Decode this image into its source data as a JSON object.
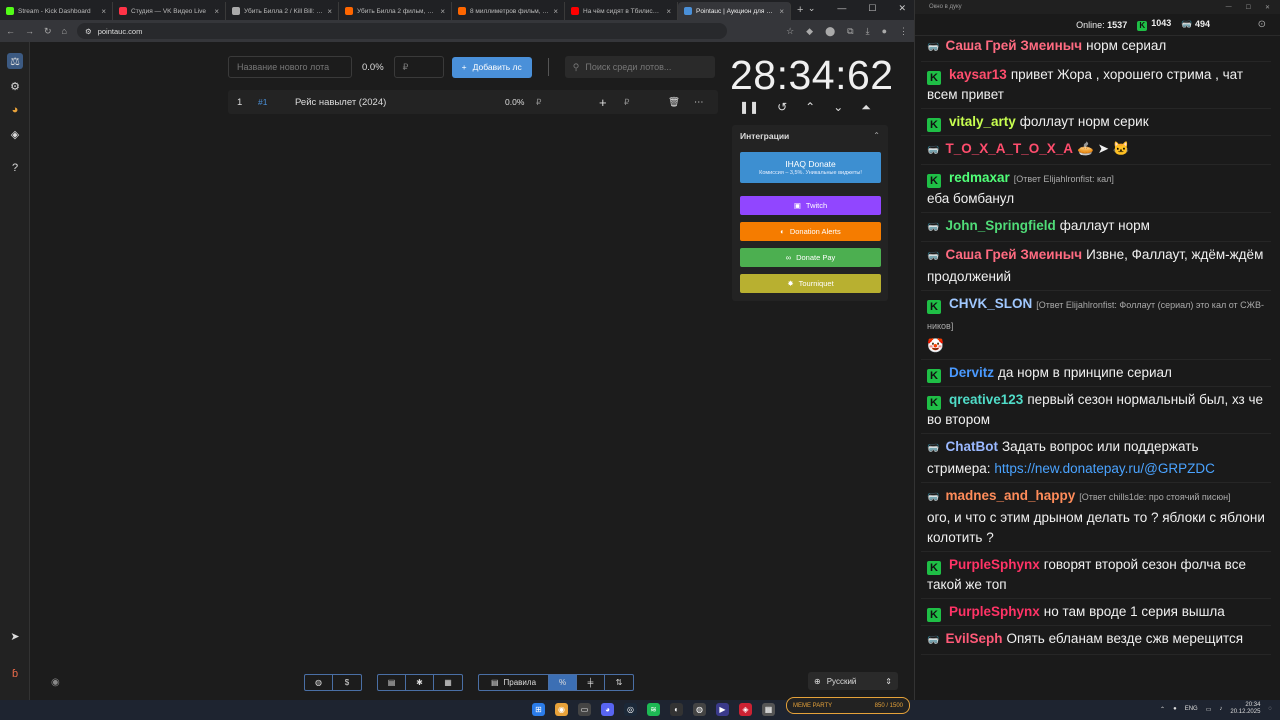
{
  "browser": {
    "tabs": [
      {
        "title": "Stream - Kick Dashboard",
        "color": "#53fc18"
      },
      {
        "title": "Студия — VK Видео Live",
        "color": "#ff3347"
      },
      {
        "title": "Убить Билла 2 / Kill Bill: Vol.",
        "color": "#aaaaaa"
      },
      {
        "title": "Убить Билла 2 фильм, 2004 -",
        "color": "#ff6600"
      },
      {
        "title": "8 миллиметров фильм, 199",
        "color": "#ff6600"
      },
      {
        "title": "На чём сидят в Тбилиси / V",
        "color": "#ff0000"
      },
      {
        "title": "Pointauc | Аукцион для стр",
        "color": "#4a90d9",
        "active": true
      }
    ],
    "url": "pointauc.com"
  },
  "auction": {
    "new_lot_placeholder": "Название нового лота",
    "percent": "0.0%",
    "amount_placeholder": "₽",
    "add_button": "Добавить лс",
    "search_placeholder": "Поиск среди лотов...",
    "lots": [
      {
        "index": "1",
        "id": "#1",
        "name": "Рейс навылет (2024)",
        "percent": "0.0%",
        "currency": "₽",
        "add_currency": "₽"
      }
    ],
    "timer": "28:34:62"
  },
  "integrations": {
    "title": "Интеграции",
    "ihaq": {
      "label": "IHAQ Donate",
      "sub": "Комиссия – 3,5%. Уникальные виджеты!"
    },
    "buttons": [
      {
        "label": "Twitch",
        "color": "#9146ff"
      },
      {
        "label": "Donation Alerts",
        "color": "#f57c00"
      },
      {
        "label": "Donate Pay",
        "color": "#4caf50"
      },
      {
        "label": "Tourniquet",
        "color": "#b8b030"
      }
    ]
  },
  "bottombar": {
    "rules": "Правила",
    "language": "Русский"
  },
  "chat": {
    "window_title": "Окно в дуку",
    "online_label": "Online:",
    "online": "1537",
    "kick_count": "1043",
    "other_count": "494",
    "messages": [
      {
        "badge": "g",
        "name": "Саша Грей Змеиныч",
        "color": "#ff6b81",
        "text": "норм сериал"
      },
      {
        "badge": "k",
        "name": "kaysar13",
        "color": "#ff4d6d",
        "text": "привет Жора , хорошего стрима , чат всем привет"
      },
      {
        "badge": "k",
        "name": "vitaly_arty",
        "color": "#c8ff50",
        "text": "фоллаут норм серик"
      },
      {
        "badge": "g",
        "name": "T_O_X_A_T_O_X_A",
        "color": "#ff4d6d",
        "text": "🥧 ➤ 🐱"
      },
      {
        "badge": "k",
        "name": "redmaxar",
        "color": "#50ff78",
        "reply": "[Ответ Elijahlronfist: кал]",
        "text": "еба бомбанул"
      },
      {
        "badge": "g",
        "name": "John_Springfield",
        "color": "#50dc78",
        "text": "фаллаут норм"
      },
      {
        "badge": "g",
        "name": "Саша Грей Змеиныч",
        "color": "#ff6b81",
        "text": "Извне, Фаллаут, ждём-ждём продолжений"
      },
      {
        "badge": "k",
        "name": "CHVK_SLON",
        "color": "#a0c8ff",
        "reply": "[Ответ Elijahlronfist: Фоллаут (сериал) это кал от СЖВ-ников]",
        "text": "🤡"
      },
      {
        "badge": "k",
        "name": "Dervitz",
        "color": "#4a9aff",
        "text": "да норм в принципе сериал"
      },
      {
        "badge": "k",
        "name": "qreative123",
        "color": "#50dcc8",
        "text": "первый сезон нормальный был, хз че во втором"
      },
      {
        "badge": "g",
        "name": "ChatBot",
        "color": "#9ab8ff",
        "text": "Задать вопрос или поддержать стримера:",
        "link": "https://new.donatepay.ru/@GRPZDC"
      },
      {
        "badge": "g",
        "name": "madnes_and_happy",
        "color": "#ff8c5a",
        "reply": "[Ответ chills1de: про стоячий писюн]",
        "text": "ого, и что с этим дрыном делать то ? яблоки с яблони колотить ?"
      },
      {
        "badge": "k",
        "name": "PurpleSphynx",
        "color": "#ff3366",
        "text": "говорят второй сезон фолча все такой же топ"
      },
      {
        "badge": "k",
        "name": "PurpleSphynx",
        "color": "#ff3366",
        "text": "но там вроде 1 серия вышла"
      },
      {
        "badge": "g",
        "name": "EvilSeph",
        "color": "#ff5a78",
        "text": "Опять ебланам везде сжв мерещится"
      }
    ]
  },
  "taskbar": {
    "meme_label": "MEME PARTY",
    "meme_progress": "850 / 1500",
    "lang": "ENG",
    "time": "20:34",
    "date": "20.12.2025"
  }
}
